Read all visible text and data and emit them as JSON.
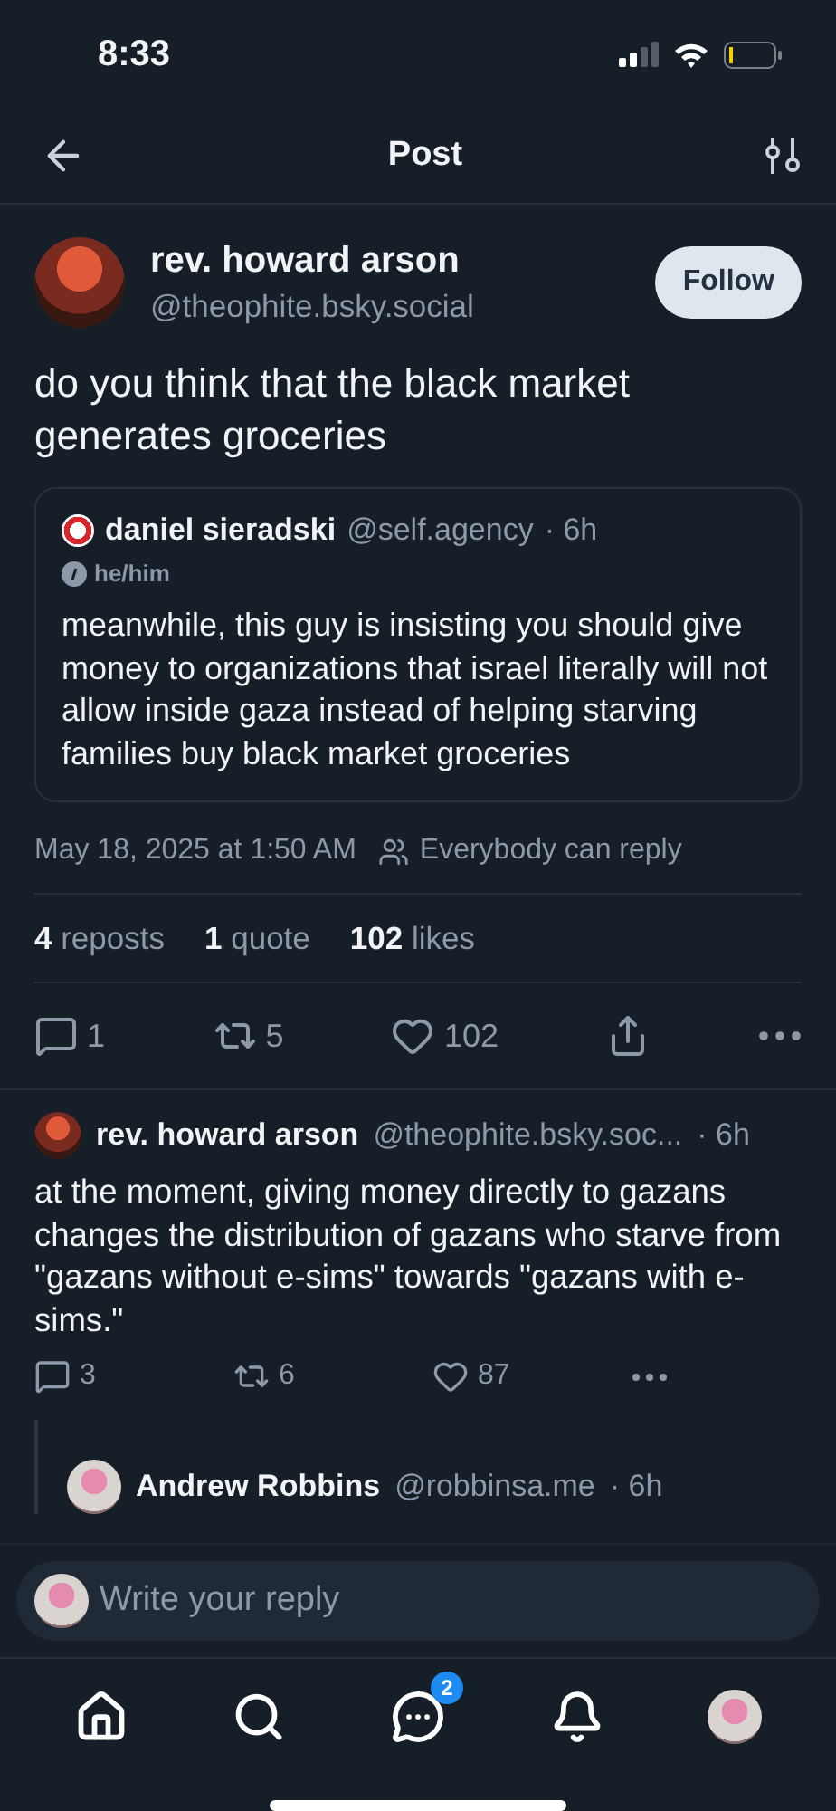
{
  "status_bar": {
    "time": "8:33"
  },
  "header": {
    "title": "Post"
  },
  "post": {
    "author": {
      "name": "rev. howard arson",
      "handle": "@theophite.bsky.social"
    },
    "follow_button": "Follow",
    "text": "do you think that the black market generates groceries",
    "quote": {
      "name": "daniel sieradski",
      "handle": "@self.agency",
      "age": "· 6h",
      "pronouns": "he/him",
      "text": "meanwhile, this guy is insisting you should give money to organizations that israel literally will not allow inside gaza instead of helping starving families buy black market groceries"
    },
    "timestamp": "May 18, 2025 at 1:50 AM",
    "reply_setting": "Everybody can reply",
    "stats": [
      {
        "count": "4",
        "label": "reposts"
      },
      {
        "count": "1",
        "label": "quote"
      },
      {
        "count": "102",
        "label": "likes"
      }
    ],
    "actions": [
      {
        "kind": "reply",
        "count": "1"
      },
      {
        "kind": "repost",
        "count": "5"
      },
      {
        "kind": "like",
        "count": "102"
      },
      {
        "kind": "share"
      },
      {
        "kind": "more"
      }
    ]
  },
  "replies": [
    {
      "name": "rev. howard arson",
      "handle": "@theophite.bsky.soc...",
      "age": "· 6h",
      "text": "at the moment, giving money directly to gazans changes the distribution of gazans who starve from \"gazans without e-sims\" towards \"gazans with e-sims.\"",
      "actions": [
        {
          "kind": "reply",
          "count": "3"
        },
        {
          "kind": "repost",
          "count": "6"
        },
        {
          "kind": "like",
          "count": "87"
        },
        {
          "kind": "more"
        }
      ],
      "children": [
        {
          "name": "Andrew Robbins",
          "handle": "@robbinsa.me",
          "age": "· 6h"
        }
      ]
    }
  ],
  "composer": {
    "placeholder": "Write your reply"
  },
  "tab_bar": [
    {
      "kind": "home",
      "selected": false
    },
    {
      "kind": "search",
      "selected": false
    },
    {
      "kind": "chat",
      "selected": false,
      "badge": "2"
    },
    {
      "kind": "notifications",
      "selected": false
    },
    {
      "kind": "profile",
      "selected": false
    }
  ]
}
